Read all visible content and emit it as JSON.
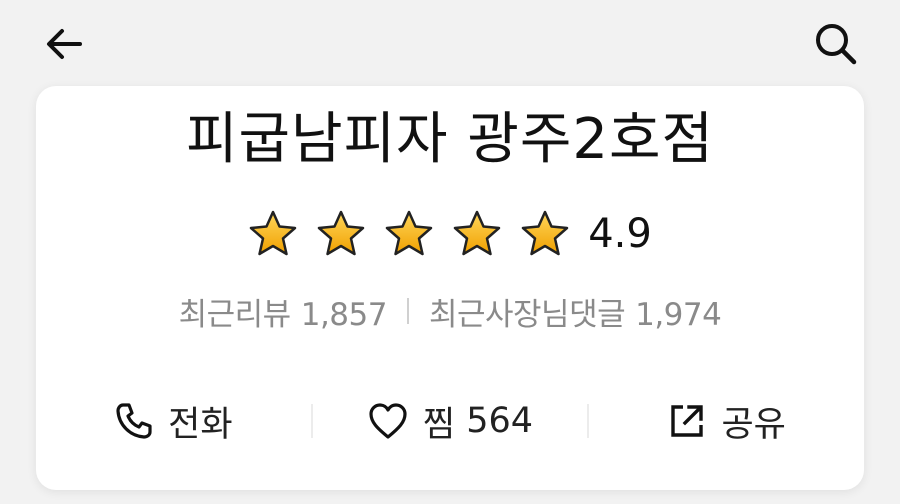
{
  "header": {
    "back_icon": "arrow-left-icon",
    "search_icon": "search-icon"
  },
  "store": {
    "name": "피굽남피자 광주2호점",
    "rating": "4.9",
    "rating_value": 4.9,
    "stars_filled": 5,
    "stars_total": 5,
    "star_color": "#f6b11a"
  },
  "counts": {
    "recent_reviews_label": "최근리뷰",
    "recent_reviews_value": "1,857",
    "owner_replies_label": "최근사장님댓글",
    "owner_replies_value": "1,974"
  },
  "actions": {
    "call_label": "전화",
    "call_icon": "phone-icon",
    "like_label": "찜",
    "like_count": "564",
    "like_icon": "heart-icon",
    "share_label": "공유",
    "share_icon": "share-icon"
  }
}
